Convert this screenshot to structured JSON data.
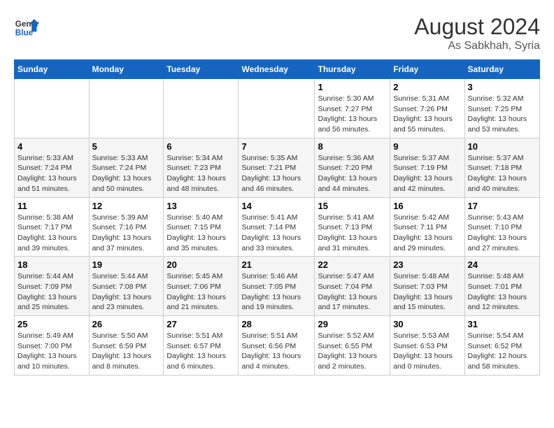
{
  "header": {
    "logo_line1": "General",
    "logo_line2": "Blue",
    "month_year": "August 2024",
    "location": "As Sabkhah, Syria"
  },
  "weekdays": [
    "Sunday",
    "Monday",
    "Tuesday",
    "Wednesday",
    "Thursday",
    "Friday",
    "Saturday"
  ],
  "weeks": [
    [
      {
        "day": "",
        "info": ""
      },
      {
        "day": "",
        "info": ""
      },
      {
        "day": "",
        "info": ""
      },
      {
        "day": "",
        "info": ""
      },
      {
        "day": "1",
        "info": "Sunrise: 5:30 AM\nSunset: 7:27 PM\nDaylight: 13 hours\nand 56 minutes."
      },
      {
        "day": "2",
        "info": "Sunrise: 5:31 AM\nSunset: 7:26 PM\nDaylight: 13 hours\nand 55 minutes."
      },
      {
        "day": "3",
        "info": "Sunrise: 5:32 AM\nSunset: 7:25 PM\nDaylight: 13 hours\nand 53 minutes."
      }
    ],
    [
      {
        "day": "4",
        "info": "Sunrise: 5:33 AM\nSunset: 7:24 PM\nDaylight: 13 hours\nand 51 minutes."
      },
      {
        "day": "5",
        "info": "Sunrise: 5:33 AM\nSunset: 7:24 PM\nDaylight: 13 hours\nand 50 minutes."
      },
      {
        "day": "6",
        "info": "Sunrise: 5:34 AM\nSunset: 7:23 PM\nDaylight: 13 hours\nand 48 minutes."
      },
      {
        "day": "7",
        "info": "Sunrise: 5:35 AM\nSunset: 7:21 PM\nDaylight: 13 hours\nand 46 minutes."
      },
      {
        "day": "8",
        "info": "Sunrise: 5:36 AM\nSunset: 7:20 PM\nDaylight: 13 hours\nand 44 minutes."
      },
      {
        "day": "9",
        "info": "Sunrise: 5:37 AM\nSunset: 7:19 PM\nDaylight: 13 hours\nand 42 minutes."
      },
      {
        "day": "10",
        "info": "Sunrise: 5:37 AM\nSunset: 7:18 PM\nDaylight: 13 hours\nand 40 minutes."
      }
    ],
    [
      {
        "day": "11",
        "info": "Sunrise: 5:38 AM\nSunset: 7:17 PM\nDaylight: 13 hours\nand 39 minutes."
      },
      {
        "day": "12",
        "info": "Sunrise: 5:39 AM\nSunset: 7:16 PM\nDaylight: 13 hours\nand 37 minutes."
      },
      {
        "day": "13",
        "info": "Sunrise: 5:40 AM\nSunset: 7:15 PM\nDaylight: 13 hours\nand 35 minutes."
      },
      {
        "day": "14",
        "info": "Sunrise: 5:41 AM\nSunset: 7:14 PM\nDaylight: 13 hours\nand 33 minutes."
      },
      {
        "day": "15",
        "info": "Sunrise: 5:41 AM\nSunset: 7:13 PM\nDaylight: 13 hours\nand 31 minutes."
      },
      {
        "day": "16",
        "info": "Sunrise: 5:42 AM\nSunset: 7:11 PM\nDaylight: 13 hours\nand 29 minutes."
      },
      {
        "day": "17",
        "info": "Sunrise: 5:43 AM\nSunset: 7:10 PM\nDaylight: 13 hours\nand 27 minutes."
      }
    ],
    [
      {
        "day": "18",
        "info": "Sunrise: 5:44 AM\nSunset: 7:09 PM\nDaylight: 13 hours\nand 25 minutes."
      },
      {
        "day": "19",
        "info": "Sunrise: 5:44 AM\nSunset: 7:08 PM\nDaylight: 13 hours\nand 23 minutes."
      },
      {
        "day": "20",
        "info": "Sunrise: 5:45 AM\nSunset: 7:06 PM\nDaylight: 13 hours\nand 21 minutes."
      },
      {
        "day": "21",
        "info": "Sunrise: 5:46 AM\nSunset: 7:05 PM\nDaylight: 13 hours\nand 19 minutes."
      },
      {
        "day": "22",
        "info": "Sunrise: 5:47 AM\nSunset: 7:04 PM\nDaylight: 13 hours\nand 17 minutes."
      },
      {
        "day": "23",
        "info": "Sunrise: 5:48 AM\nSunset: 7:03 PM\nDaylight: 13 hours\nand 15 minutes."
      },
      {
        "day": "24",
        "info": "Sunrise: 5:48 AM\nSunset: 7:01 PM\nDaylight: 13 hours\nand 12 minutes."
      }
    ],
    [
      {
        "day": "25",
        "info": "Sunrise: 5:49 AM\nSunset: 7:00 PM\nDaylight: 13 hours\nand 10 minutes."
      },
      {
        "day": "26",
        "info": "Sunrise: 5:50 AM\nSunset: 6:59 PM\nDaylight: 13 hours\nand 8 minutes."
      },
      {
        "day": "27",
        "info": "Sunrise: 5:51 AM\nSunset: 6:57 PM\nDaylight: 13 hours\nand 6 minutes."
      },
      {
        "day": "28",
        "info": "Sunrise: 5:51 AM\nSunset: 6:56 PM\nDaylight: 13 hours\nand 4 minutes."
      },
      {
        "day": "29",
        "info": "Sunrise: 5:52 AM\nSunset: 6:55 PM\nDaylight: 13 hours\nand 2 minutes."
      },
      {
        "day": "30",
        "info": "Sunrise: 5:53 AM\nSunset: 6:53 PM\nDaylight: 13 hours\nand 0 minutes."
      },
      {
        "day": "31",
        "info": "Sunrise: 5:54 AM\nSunset: 6:52 PM\nDaylight: 12 hours\nand 58 minutes."
      }
    ]
  ]
}
